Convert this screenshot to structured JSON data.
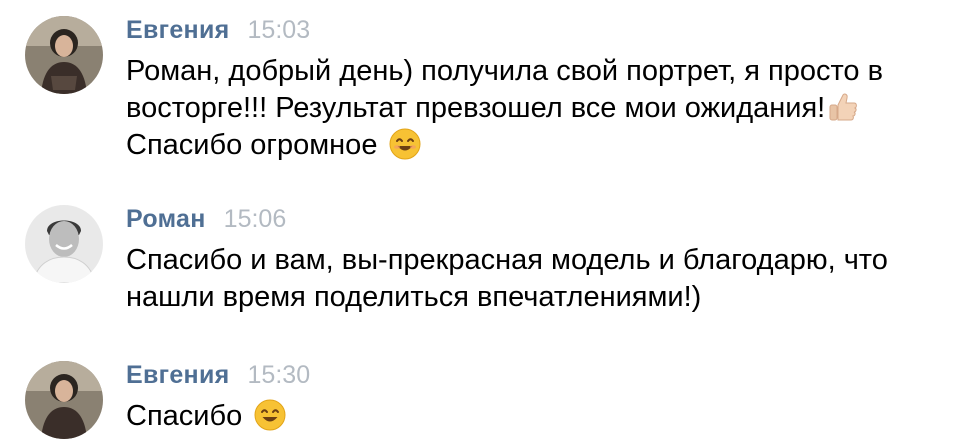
{
  "messages": [
    {
      "author": "Евгения",
      "time": "15:03",
      "avatar_icon": "woman-portrait-avatar",
      "lines": [
        "Роман, добрый день) получила свой портрет, я просто в",
        "восторге!!! Результат превзошел все мои ожидания!",
        "Спасибо огромное"
      ],
      "emojis": [
        "thumbs-up-icon",
        "smiling-face-icon"
      ]
    },
    {
      "author": "Роман",
      "time": "15:06",
      "avatar_icon": "man-portrait-avatar",
      "lines": [
        "Спасибо и вам, вы-прекрасная модель и благодарю, что",
        "нашли время поделиться впечатлениями!)"
      ]
    },
    {
      "author": "Евгения",
      "time": "15:30",
      "avatar_icon": "woman-portrait-avatar",
      "lines": [
        "Спасибо"
      ],
      "emojis": [
        "smiling-face-icon"
      ]
    }
  ],
  "colors": {
    "author": "#4f6f94",
    "time": "#b3bac2",
    "text": "#000000",
    "emoji_face": "#f7c234",
    "thumb": "#f3d3b8"
  }
}
